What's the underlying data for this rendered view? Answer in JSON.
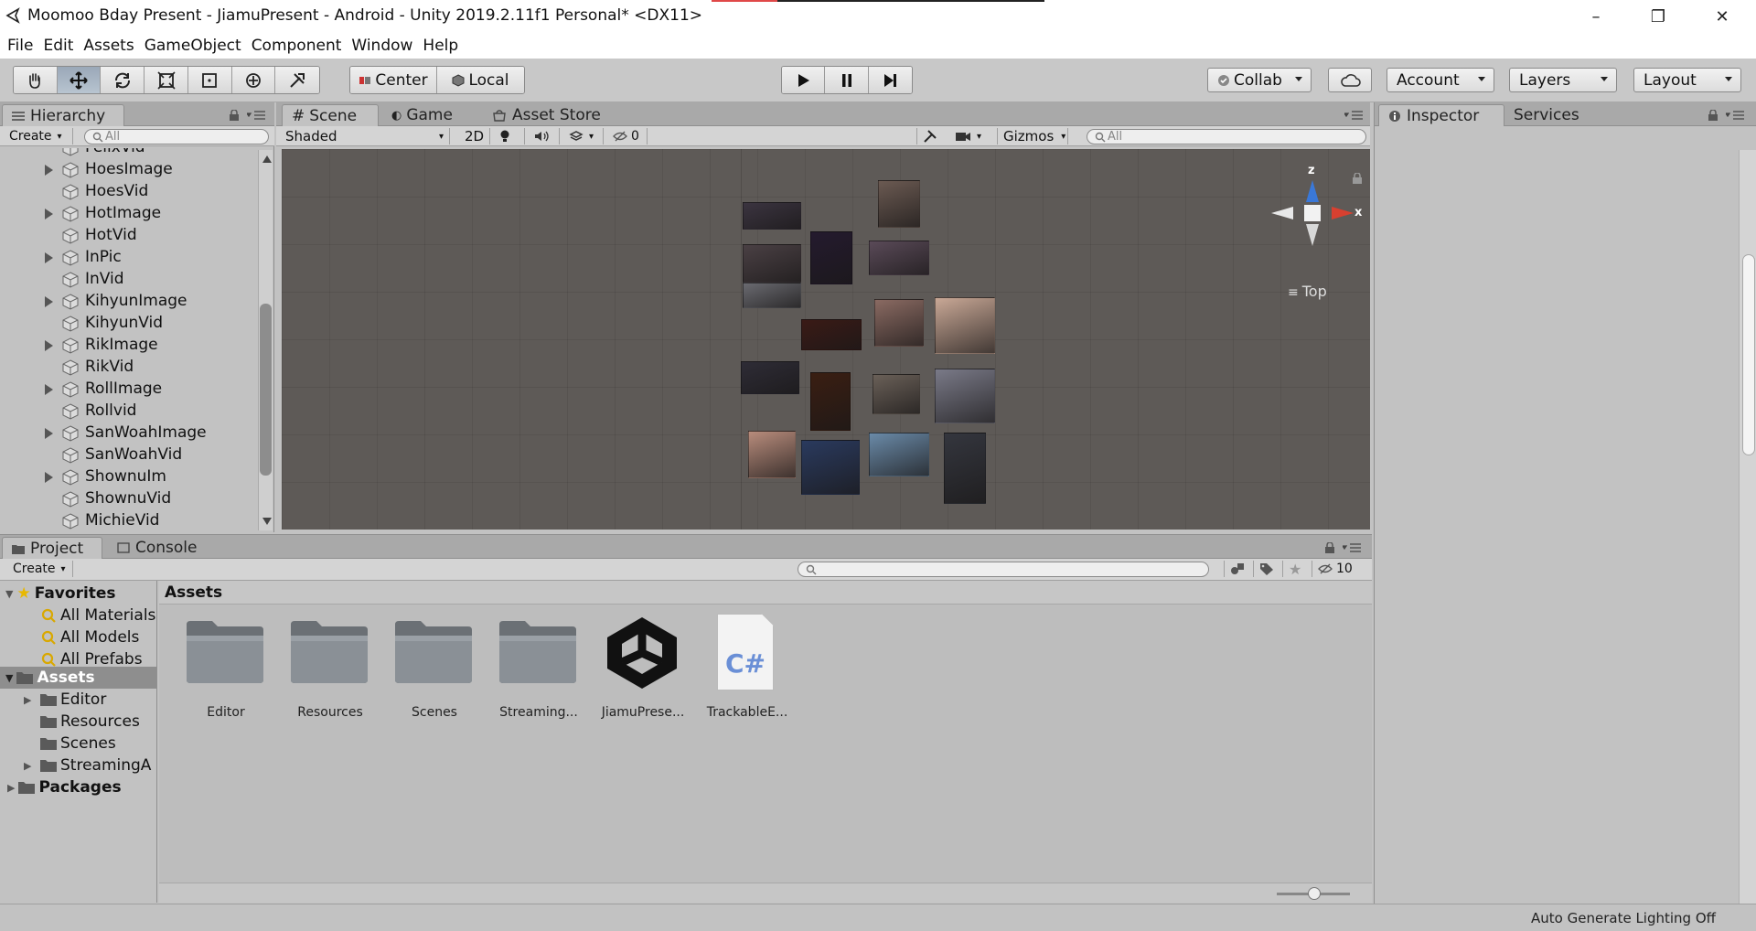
{
  "window": {
    "title": "Moomoo Bday Present - JiamuPresent - Android - Unity 2019.2.11f1 Personal* <DX11>",
    "minimize": "–",
    "maximize": "❐",
    "close": "✕"
  },
  "menu": [
    "File",
    "Edit",
    "Assets",
    "GameObject",
    "Component",
    "Window",
    "Help"
  ],
  "toolbar": {
    "pivot": "Center",
    "space": "Local",
    "collab": "Collab",
    "account": "Account",
    "layers": "Layers",
    "layout": "Layout"
  },
  "hierarchy": {
    "tab": "Hierarchy",
    "create": "Create",
    "search_placeholder": "All",
    "items": [
      {
        "label": "FelixVid",
        "expandable": false
      },
      {
        "label": "HoesImage",
        "expandable": true
      },
      {
        "label": "HoesVid",
        "expandable": false
      },
      {
        "label": "HotImage",
        "expandable": true
      },
      {
        "label": "HotVid",
        "expandable": false
      },
      {
        "label": "InPic",
        "expandable": true
      },
      {
        "label": "InVid",
        "expandable": false
      },
      {
        "label": "KihyunImage",
        "expandable": true
      },
      {
        "label": "KihyunVid",
        "expandable": false
      },
      {
        "label": "RikImage",
        "expandable": true
      },
      {
        "label": "RikVid",
        "expandable": false
      },
      {
        "label": "RollImage",
        "expandable": true
      },
      {
        "label": "Rollvid",
        "expandable": false
      },
      {
        "label": "SanWoahImage",
        "expandable": true
      },
      {
        "label": "SanWoahVid",
        "expandable": false
      },
      {
        "label": "ShownuIm",
        "expandable": true
      },
      {
        "label": "ShownuVid",
        "expandable": false
      },
      {
        "label": "MichieVid",
        "expandable": false
      }
    ]
  },
  "scene": {
    "tabs": [
      "Scene",
      "Game",
      "Asset Store"
    ],
    "shading": "Shaded",
    "mode_2d": "2D",
    "hidden_count": "0",
    "gizmos": "Gizmos",
    "search_placeholder": "All",
    "axis_z": "z",
    "axis_x": "x",
    "view_label": "Top"
  },
  "inspector": {
    "tabs": [
      "Inspector",
      "Services"
    ]
  },
  "project": {
    "tabs": [
      "Project",
      "Console"
    ],
    "create": "Create",
    "hidden_count": "10",
    "breadcrumb": "Assets",
    "favorites_label": "Favorites",
    "favorites": [
      "All Materials",
      "All Models",
      "All Prefabs"
    ],
    "assets_label": "Assets",
    "asset_tree": [
      {
        "label": "Editor",
        "expandable": true
      },
      {
        "label": "Resources",
        "expandable": false
      },
      {
        "label": "Scenes",
        "expandable": false
      },
      {
        "label": "StreamingA",
        "expandable": true
      }
    ],
    "packages_label": "Packages",
    "grid": [
      {
        "label": "Editor",
        "kind": "folder"
      },
      {
        "label": "Resources",
        "kind": "folder"
      },
      {
        "label": "Scenes",
        "kind": "folder"
      },
      {
        "label": "Streaming...",
        "kind": "folder"
      },
      {
        "label": "JiamuPrese...",
        "kind": "unity-scene"
      },
      {
        "label": "TrackableE...",
        "kind": "csharp-script"
      }
    ],
    "csharp_glyph": "C#"
  },
  "status": {
    "text": "Auto Generate Lighting Off"
  },
  "colors": {
    "scene_bg": "#5e5a57",
    "panel_bg": "#c2c2c2",
    "selected_row": "#8e8e8e",
    "gizmo_z": "#3a78d8",
    "gizmo_x": "#d84030"
  }
}
